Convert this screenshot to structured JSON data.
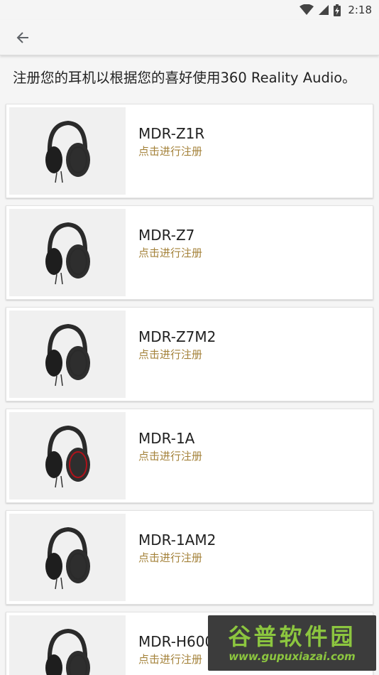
{
  "status_bar": {
    "time": "2:18"
  },
  "app_bar": {
    "back_icon": "arrow-back-icon"
  },
  "intro_text": "注册您的耳机以根据您的喜好使用360 Reality Audio。",
  "headphones": [
    {
      "name": "MDR-Z1R",
      "action": "点击进行注册",
      "accent": "#2a2a2a"
    },
    {
      "name": "MDR-Z7",
      "action": "点击进行注册",
      "accent": "#2a2a2a"
    },
    {
      "name": "MDR-Z7M2",
      "action": "点击进行注册",
      "accent": "#2a2a2a"
    },
    {
      "name": "MDR-1A",
      "action": "点击进行注册",
      "accent": "#b0121b"
    },
    {
      "name": "MDR-1AM2",
      "action": "点击进行注册",
      "accent": "#2a2a2a"
    },
    {
      "name": "MDR-H600A",
      "action": "点击进行注册",
      "accent": "#2a2a2a"
    }
  ],
  "colors": {
    "link": "#a4823a",
    "background": "#f5f5f5",
    "card": "#ffffff",
    "thumb_bg": "#f0f0f0"
  },
  "watermark": {
    "text": "谷普软件园",
    "url": "www.gupuxiazai.com"
  }
}
